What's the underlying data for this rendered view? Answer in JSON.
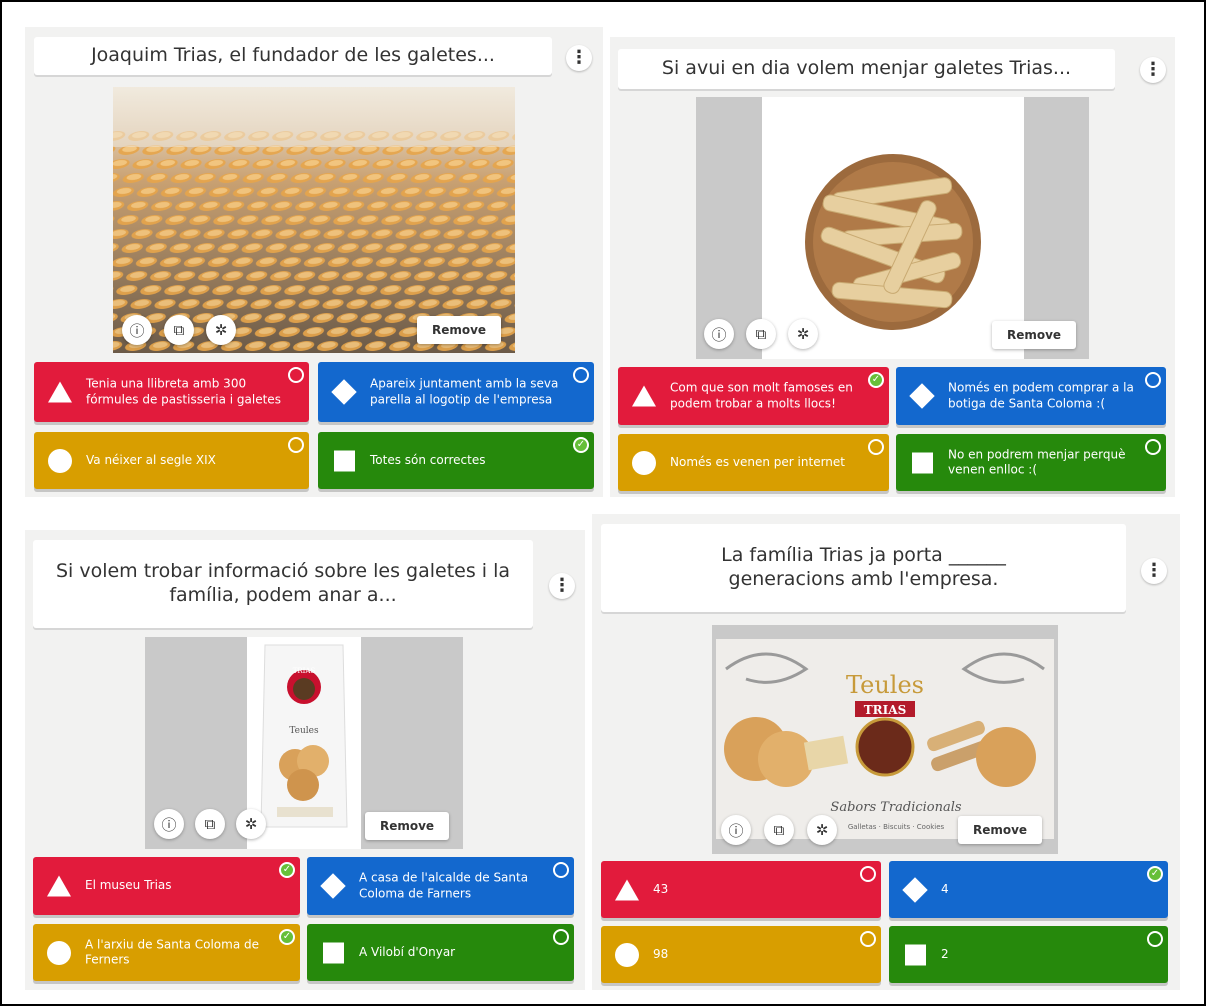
{
  "cards": [
    {
      "question": "Joaquim Trias, el fundador de les galetes...",
      "remove_label": "Remove",
      "answers": [
        {
          "text": "Tenia una llibreta amb 300 fórmules de pastisseria i galetes",
          "correct": false
        },
        {
          "text": "Apareix juntament amb la seva parella al logotip de l'empresa",
          "correct": false
        },
        {
          "text": "Va néixer al segle XIX",
          "correct": false
        },
        {
          "text": "Totes són correctes",
          "correct": true
        }
      ]
    },
    {
      "question": "Si avui en dia volem menjar galetes Trias...",
      "remove_label": "Remove",
      "answers": [
        {
          "text": "Com que son molt famoses en podem trobar a molts llocs!",
          "correct": true
        },
        {
          "text": "Només en podem comprar a la botiga de Santa Coloma :(",
          "correct": false
        },
        {
          "text": "Només es venen per internet",
          "correct": false
        },
        {
          "text": "No en podrem menjar perquè venen enlloc :(",
          "correct": false
        }
      ]
    },
    {
      "question": "Si volem trobar informació sobre les galetes i la família, podem anar a...",
      "remove_label": "Remove",
      "answers": [
        {
          "text": "El museu Trias",
          "correct": true
        },
        {
          "text": "A casa de l'alcalde de Santa Coloma de Farners",
          "correct": false
        },
        {
          "text": "A l'arxiu de Santa Coloma de Ferners",
          "correct": true
        },
        {
          "text": "A Vilobí d'Onyar",
          "correct": false
        }
      ]
    },
    {
      "question": "La família Trias ja porta ______ generacions amb l'empresa.",
      "remove_label": "Remove",
      "answers": [
        {
          "text": "43",
          "correct": false
        },
        {
          "text": "4",
          "correct": true
        },
        {
          "text": "98",
          "correct": false
        },
        {
          "text": "2",
          "correct": false
        }
      ]
    }
  ],
  "images": {
    "card4_brand_text": "Teules",
    "card4_logo_text": "TRIAS",
    "card4_tagline": "Sabors Tradicionals",
    "card4_product_line": "Galletas · Biscuits · Cookies",
    "card3_package_brand": "TRIAS",
    "card3_package_name": "Teules"
  },
  "icons": {
    "kebab": "⋮",
    "info": "ⓘ",
    "crop": "⧉",
    "magic": "✲",
    "check": "✓"
  },
  "colors": {
    "red": "#e21b3c",
    "blue": "#1368ce",
    "yellow": "#d89e00",
    "green": "#26890c",
    "correct": "#66bf39"
  }
}
